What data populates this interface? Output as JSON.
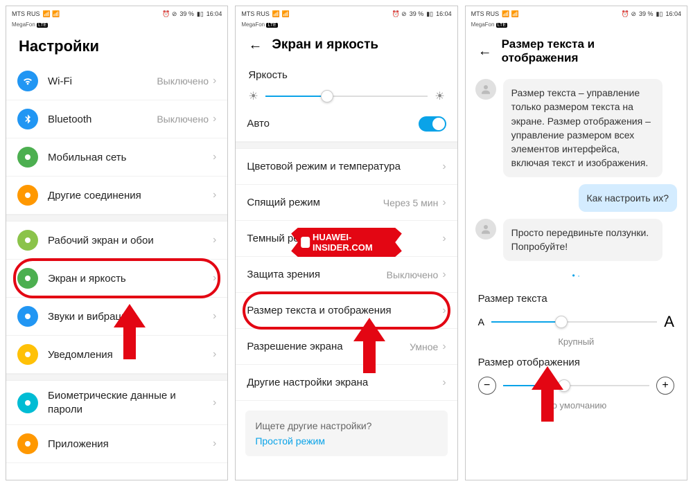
{
  "status": {
    "carrier": "MTS RUS",
    "subcarrier": "MegaFon",
    "lte": "LTE",
    "battery": "39 %",
    "time": "16:04"
  },
  "s1": {
    "title": "Настройки",
    "items": [
      {
        "label": "Wi-Fi",
        "value": "Выключено",
        "color": "bg-blue",
        "name": "wifi"
      },
      {
        "label": "Bluetooth",
        "value": "Выключено",
        "color": "bg-blue",
        "name": "bluetooth"
      },
      {
        "label": "Мобильная сеть",
        "value": "",
        "color": "bg-green",
        "name": "mobile-network"
      },
      {
        "label": "Другие соединения",
        "value": "",
        "color": "bg-orange",
        "name": "other-connections"
      },
      {
        "label": "Рабочий экран и обои",
        "value": "",
        "color": "bg-green2",
        "name": "home-wallpaper"
      },
      {
        "label": "Экран и яркость",
        "value": "",
        "color": "bg-green",
        "name": "display-brightness",
        "highlight": true
      },
      {
        "label": "Звуки и вибрация",
        "value": "",
        "color": "bg-blue",
        "name": "sounds"
      },
      {
        "label": "Уведомления",
        "value": "",
        "color": "bg-amber",
        "name": "notifications"
      },
      {
        "label": "Биометрические данные и пароли",
        "value": "",
        "color": "bg-cyan",
        "name": "biometrics"
      },
      {
        "label": "Приложения",
        "value": "",
        "color": "bg-orange",
        "name": "apps"
      }
    ]
  },
  "s2": {
    "title": "Экран и яркость",
    "brightness_label": "Яркость",
    "auto_label": "Авто",
    "items": [
      {
        "label": "Цветовой режим и температура",
        "value": "",
        "name": "color-mode"
      },
      {
        "label": "Спящий режим",
        "value": "Через 5 мин",
        "name": "sleep"
      },
      {
        "label": "Темный режим",
        "value": "",
        "name": "dark-mode"
      },
      {
        "label": "Защита зрения",
        "value": "Выключено",
        "name": "eye-comfort"
      },
      {
        "label": "Размер текста и отображения",
        "value": "",
        "name": "text-size",
        "highlight": true
      },
      {
        "label": "Разрешение экрана",
        "value": "Умное",
        "name": "resolution"
      },
      {
        "label": "Другие настройки экрана",
        "value": "",
        "name": "more-display"
      }
    ],
    "info_q": "Ищете другие настройки?",
    "info_link": "Простой режим"
  },
  "s3": {
    "title": "Размер текста и отображения",
    "msg1": "Размер текста – управление только размером текста на экране. Размер отображения – управление размером всех элементов интерфейса, включая текст и изображения.",
    "msg2": "Как настроить их?",
    "msg3": "Просто передвиньте ползунки. Попробуйте!",
    "text_size_label": "Размер текста",
    "text_size_value": "Крупный",
    "display_size_label": "Размер отображения",
    "display_size_value": "По умолчанию"
  },
  "watermark": "HUAWEI-INSIDER.COM"
}
